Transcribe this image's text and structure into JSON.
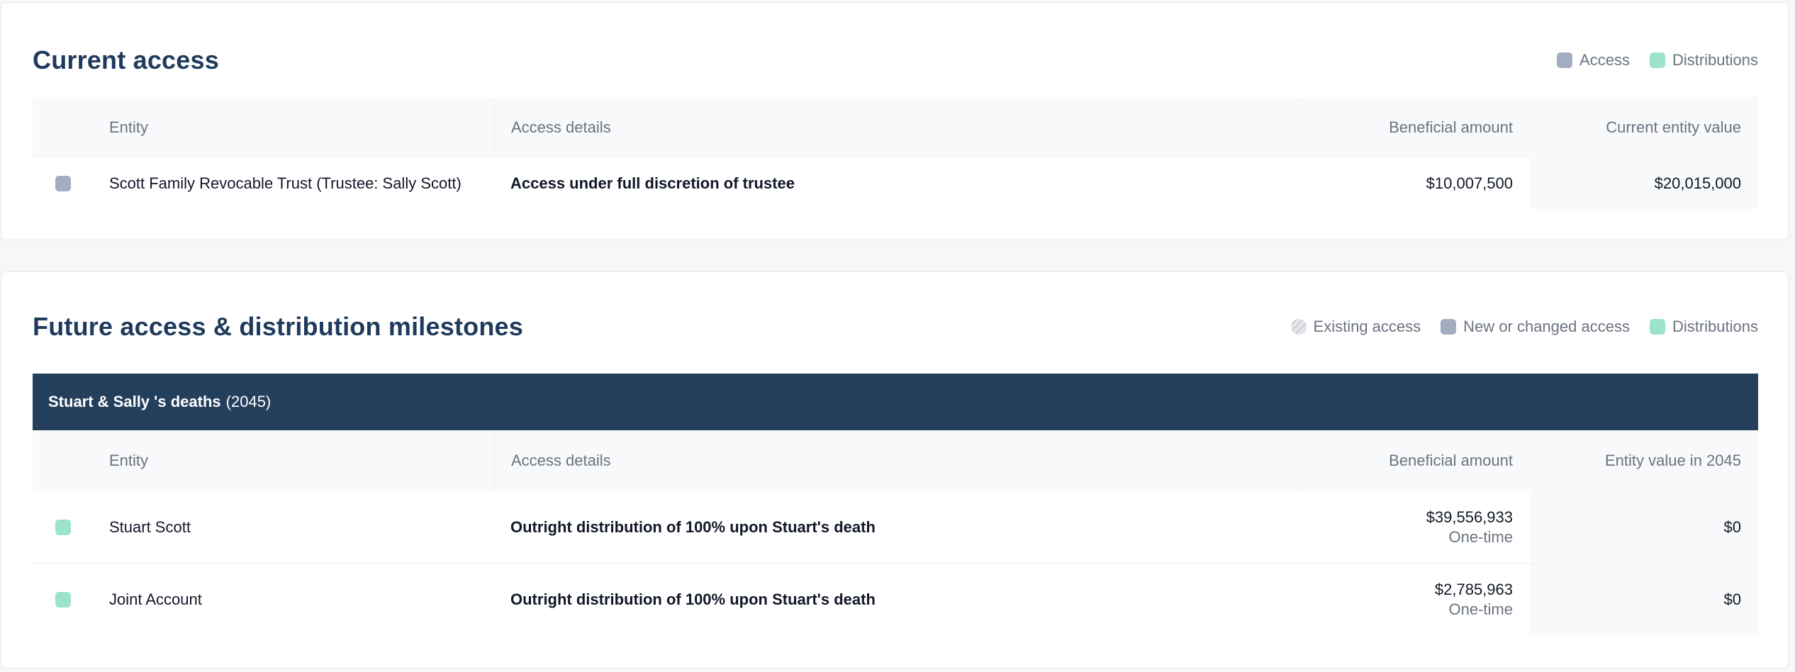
{
  "current_access": {
    "title": "Current access",
    "legend": [
      {
        "label": "Access",
        "color": "#a3adbf"
      },
      {
        "label": "Distributions",
        "color": "#9be3c9"
      }
    ],
    "columns": {
      "entity": "Entity",
      "details": "Access details",
      "amount": "Beneficial amount",
      "value": "Current entity value"
    },
    "rows": [
      {
        "indicator": "access",
        "entity": "Scott Family Revocable Trust (Trustee: Sally Scott)",
        "details": "Access under full discretion of trustee",
        "amount": "$10,007,500",
        "value": "$20,015,000"
      }
    ]
  },
  "future_access": {
    "title": "Future access & distribution milestones",
    "legend": [
      {
        "label": "Existing access",
        "icon": "hatched-circle-icon"
      },
      {
        "label": "New or changed access",
        "color": "#a3adbf"
      },
      {
        "label": "Distributions",
        "color": "#9be3c9"
      }
    ],
    "milestone": {
      "label": "Stuart & Sally 's deaths",
      "year": "(2045)",
      "color": "#243f5c"
    },
    "columns": {
      "entity": "Entity",
      "details": "Access details",
      "amount": "Beneficial amount",
      "value": "Entity value in 2045"
    },
    "rows": [
      {
        "indicator": "distribution",
        "entity": "Stuart Scott",
        "details": "Outright distribution of 100% upon Stuart's death",
        "amount": "$39,556,933",
        "amount_sub": "One-time",
        "value": "$0"
      },
      {
        "indicator": "distribution",
        "entity": "Joint Account",
        "details": "Outright distribution of 100% upon Stuart's death",
        "amount": "$2,785,963",
        "amount_sub": "One-time",
        "value": "$0"
      }
    ]
  }
}
